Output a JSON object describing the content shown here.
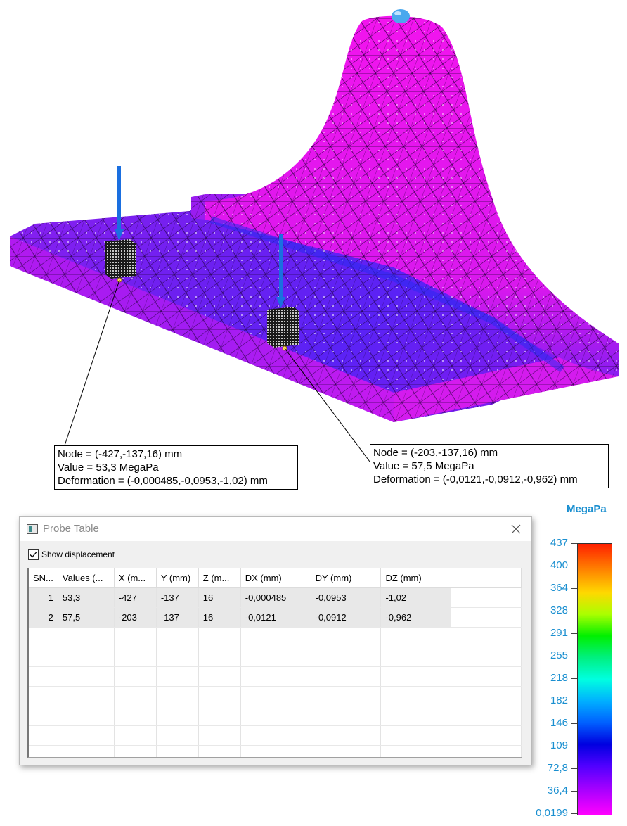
{
  "probes": [
    {
      "node": "Node = (-427,-137,16) mm",
      "value": "Value = 53,3 MegaPa",
      "deformation": "Deformation = (-0,000485,-0,0953,-1,02) mm"
    },
    {
      "node": "Node = (-203,-137,16) mm",
      "value": "Value = 57,5 MegaPa",
      "deformation": "Deformation = (-0,0121,-0,0912,-0,962) mm"
    }
  ],
  "legend": {
    "unit": "MegaPa",
    "ticks": [
      "437",
      "400",
      "364",
      "328",
      "291",
      "255",
      "218",
      "182",
      "146",
      "109",
      "72,8",
      "36,4",
      "0,0199"
    ]
  },
  "window": {
    "title": "Probe Table",
    "close_icon": "close-icon",
    "show_displacement_label": "Show displacement",
    "show_displacement_checked": true,
    "columns": [
      "SN...",
      "Values (...",
      "X (m...",
      "Y (mm)",
      "Z (m...",
      "DX (mm)",
      "DY (mm)",
      "DZ (mm)"
    ],
    "rows": [
      [
        "1",
        "53,3",
        "-427",
        "-137",
        "16",
        "-0,000485",
        "-0,0953",
        "-1,02"
      ],
      [
        "2",
        "57,5",
        "-203",
        "-137",
        "16",
        "-0,0121",
        "-0,0912",
        "-0,962"
      ]
    ]
  },
  "colors": {
    "mesh_primary": "#e816ee",
    "mesh_low": "#7a1cf0",
    "load_arrow": "#1a6fe0",
    "legend_text": "#1a8fd0"
  }
}
